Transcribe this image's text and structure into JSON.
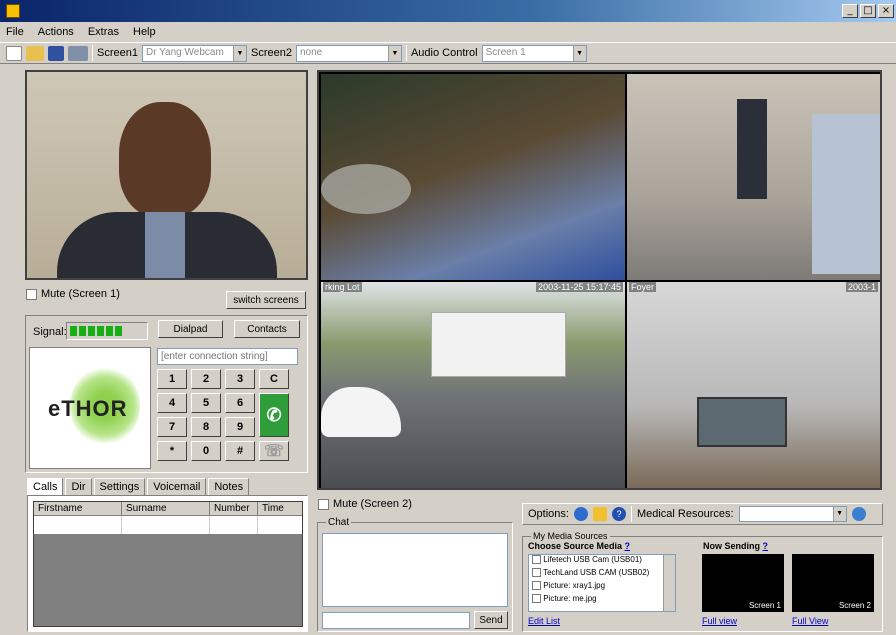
{
  "window": {
    "min": "_",
    "max": "□",
    "close": "×"
  },
  "menu": [
    "File",
    "Actions",
    "Extras",
    "Help"
  ],
  "toolbar": {
    "screen1_label": "Screen1",
    "screen1_value": "Dr Yang Webcam",
    "screen2_label": "Screen2",
    "screen2_value": "none",
    "audio_label": "Audio Control",
    "audio_value": "Screen 1"
  },
  "left": {
    "mute_screen1": "Mute (Screen 1)",
    "switch_screens": "switch screens",
    "signal_label": "Signal:",
    "signal_bars": 6,
    "dialpad": "Dialpad",
    "contacts": "Contacts",
    "connection_placeholder": "[enter connection string]",
    "logo_text": "eTHOR",
    "keys": [
      "1",
      "2",
      "3",
      "C",
      "4",
      "5",
      "6",
      "",
      "7",
      "8",
      "9",
      "",
      "*",
      "0",
      "#",
      ""
    ],
    "tabs": [
      "Calls",
      "Dir",
      "Settings",
      "Voicemail",
      "Notes"
    ],
    "columns": [
      "Firstname",
      "Surname",
      "Number",
      "Time"
    ]
  },
  "video": {
    "cam3_label": "rking Lot",
    "cam3_time": "2003-11-25 15:17:45",
    "cam4_label": "Foyer",
    "cam4_time": "2003-1"
  },
  "bottom": {
    "mute_screen2": "Mute (Screen 2)",
    "chat_label": "Chat",
    "send": "Send",
    "options_label": "Options:",
    "medical_label": "Medical Resources:",
    "media_sources": "My Media Sources",
    "choose_source": "Choose Source Media",
    "help_q": "?",
    "now_sending": "Now Sending",
    "media_items": [
      "Lifetech USB Cam (USB01)",
      "TechLand USB CAM (USB02)",
      "Picture: xray1.jpg",
      "Picture: me.jpg"
    ],
    "edit_list": "Edit List",
    "screen1": "Screen 1",
    "screen2": "Screen 2",
    "full_view_1": "Full view",
    "full_view_2": "Full View"
  }
}
